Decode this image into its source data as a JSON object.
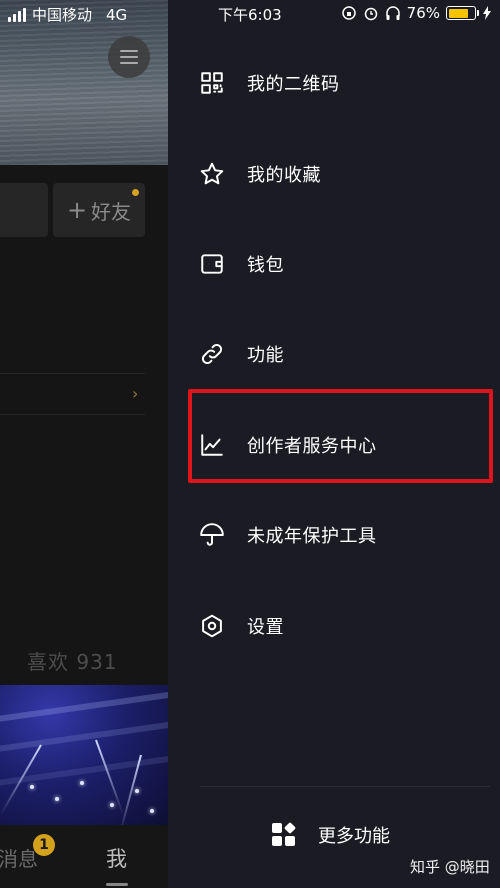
{
  "status_bar": {
    "carrier": "中国移动",
    "network": "4G",
    "time": "下午6:03",
    "battery_percent": "76%",
    "battery_level": 0.76,
    "battery_color": "#f7c500"
  },
  "profile_bg": {
    "add_friend_label": "好友",
    "likes_label": "喜欢 931",
    "tab_messages": "消息",
    "tab_messages_badge": "1",
    "tab_me": "我"
  },
  "drawer": {
    "items": [
      {
        "label": "我的二维码",
        "icon": "qr-code-icon"
      },
      {
        "label": "我的收藏",
        "icon": "star-icon"
      },
      {
        "label": "钱包",
        "icon": "wallet-icon"
      },
      {
        "label": "功能",
        "icon": "link-icon"
      },
      {
        "label": "创作者服务中心",
        "icon": "chart-icon"
      },
      {
        "label": "未成年保护工具",
        "icon": "umbrella-icon"
      },
      {
        "label": "设置",
        "icon": "settings-icon"
      }
    ],
    "more_label": "更多功能",
    "highlight_color": "#e0141c"
  },
  "watermark": "知乎 @晓田"
}
